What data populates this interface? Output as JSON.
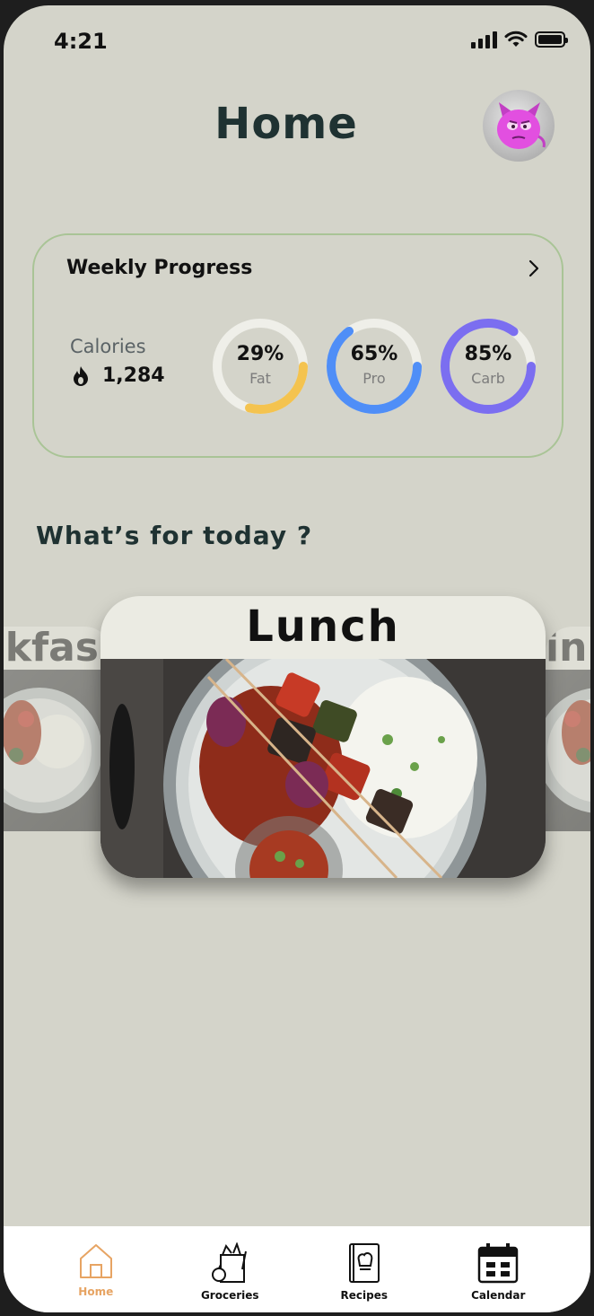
{
  "status_bar": {
    "time": "4:21"
  },
  "header": {
    "title": "Home"
  },
  "weekly_progress": {
    "title": "Weekly Progress",
    "calories_label": "Calories",
    "calories_value": "1,284",
    "rings": [
      {
        "name": "Fat",
        "percent_label": "29%",
        "value": 29,
        "color": "#f4c34f"
      },
      {
        "name": "Pro",
        "percent_label": "65%",
        "value": 65,
        "color": "#4f8ef7"
      },
      {
        "name": "Carb",
        "percent_label": "85%",
        "value": 85,
        "color": "#7b6ef0"
      }
    ]
  },
  "today": {
    "title": "What’s for today ?",
    "meals": {
      "left": "kfas",
      "center": "Lunch",
      "right": "inn"
    }
  },
  "tabs": [
    {
      "label": "Home",
      "icon": "home-icon",
      "active": true
    },
    {
      "label": "Groceries",
      "icon": "grocery-bag-icon",
      "active": false
    },
    {
      "label": "Recipes",
      "icon": "recipe-book-icon",
      "active": false
    },
    {
      "label": "Calendar",
      "icon": "calendar-icon",
      "active": false
    }
  ],
  "colors": {
    "accent": "#e7a463",
    "background": "#d4d4ca",
    "card_border": "#a9c496"
  }
}
